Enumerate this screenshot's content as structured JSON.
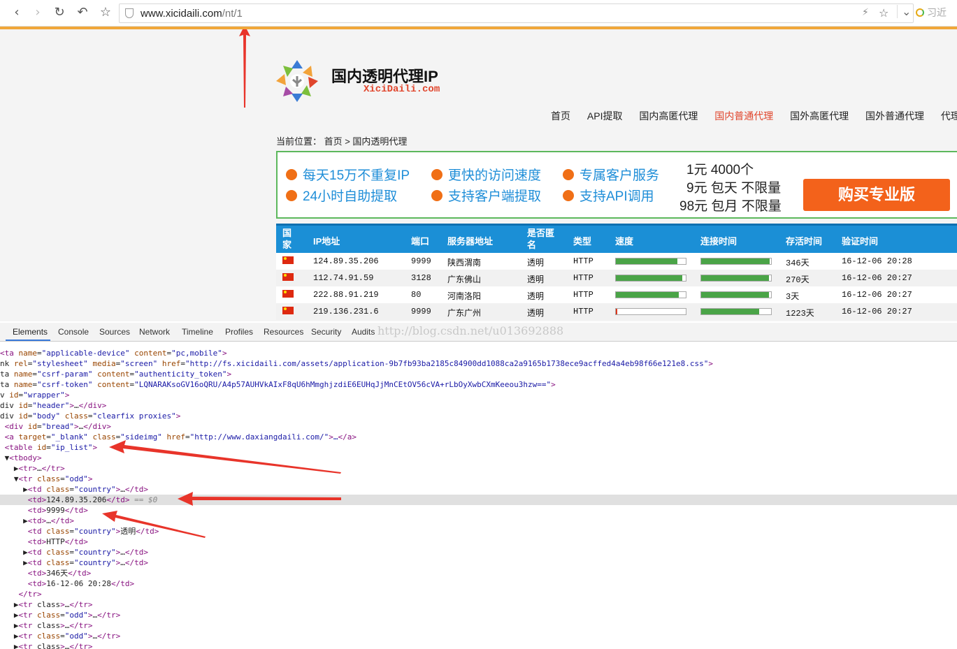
{
  "browser": {
    "url_domain": "www.xicidaili.com",
    "url_path": "/nt/1",
    "search_text": "习近",
    "back_icon": "‹",
    "forward_icon": "›",
    "reload_icon": "↻",
    "undo_icon": "↶",
    "star_icon": "☆",
    "bolt_icon": "⚡",
    "star2_icon": "☆",
    "dropdown_icon": "⌄"
  },
  "site": {
    "title": "国内透明代理IP",
    "title_en": "XiciDaili.com",
    "nav": [
      "首页",
      "API提取",
      "国内高匿代理",
      "国内普通代理",
      "国外高匿代理",
      "国外普通代理",
      "代理小"
    ],
    "breadcrumb": "当前位置： 首页 > 国内透明代理"
  },
  "promo": {
    "items": [
      "每天15万不重复IP",
      "更快的访问速度",
      "专属客户服务",
      "24小时自助提取",
      "支持客户端提取",
      "支持API调用"
    ],
    "prices": [
      "1元 4000个",
      "9元 包天 不限量",
      "98元 包月 不限量"
    ],
    "buy_label": "购买专业版"
  },
  "table": {
    "headers": [
      "国家",
      "IP地址",
      "端口",
      "服务器地址",
      "是否匿名",
      "类型",
      "速度",
      "连接时间",
      "存活时间",
      "验证时间"
    ],
    "rows": [
      {
        "ip": "124.89.35.206",
        "port": "9999",
        "location": "陕西渭南",
        "anonymity": "透明",
        "type": "HTTP",
        "speed": 0.88,
        "conn": 0.98,
        "alive": "346天",
        "verified": "16-12-06 20:28"
      },
      {
        "ip": "112.74.91.59",
        "port": "3128",
        "location": "广东佛山",
        "anonymity": "透明",
        "type": "HTTP",
        "speed": 0.95,
        "conn": 0.97,
        "alive": "270天",
        "verified": "16-12-06 20:27"
      },
      {
        "ip": "222.88.91.219",
        "port": "80",
        "location": "河南洛阳",
        "anonymity": "透明",
        "type": "HTTP",
        "speed": 0.9,
        "conn": 0.97,
        "alive": "3天",
        "verified": "16-12-06 20:27"
      },
      {
        "ip": "219.136.231.6",
        "port": "9999",
        "location": "广东广州",
        "anonymity": "透明",
        "type": "HTTP",
        "speed": 0.02,
        "conn": 0.83,
        "alive": "1223天",
        "verified": "16-12-06 20:27"
      }
    ]
  },
  "devtools": {
    "tabs": [
      "Elements",
      "Console",
      "Sources",
      "Network",
      "Timeline",
      "Profiles",
      "Resources",
      "Security",
      "Audits"
    ],
    "watermark": "http://blog.csdn.net/u013692888",
    "lines": [
      "<ta name=\"applicable-device\" content=\"pc,mobile\">",
      "nk rel=\"stylesheet\" media=\"screen\" href=\"http://fs.xicidaili.com/assets/application-9b7fb93ba2185c84900dd1088ca2a9165b1738ece9acffed4a4eb98f66e121e8.css\">",
      "ta name=\"csrf-param\" content=\"authenticity_token\">",
      "ta name=\"csrf-token\" content=\"LQNARAKsoGV16oQRU/A4p57AUHVkAIxF8qU6hMmghjzdiE6EUHqJjMnCEtOV56cVA+rLbOyXwbCXmKeeou3hzw==\">",
      "v id=\"wrapper\">",
      "div id=\"header\">…</div>",
      "div id=\"body\" class=\"clearfix proxies\">",
      " <div id=\"bread\">…</div>",
      " <a target=\"_blank\" class=\"sideimg\" href=\"http://www.daxiangdaili.com/\">…</a>",
      " <table id=\"ip_list\">",
      " ▼<tbody>",
      "   ▶<tr>…</tr>",
      "   ▼<tr class=\"odd\">",
      "     ▶<td class=\"country\">…</td>",
      "      <td>124.89.35.206</td> == $0",
      "      <td>9999</td>",
      "     ▶<td>…</td>",
      "      <td class=\"country\">透明</td>",
      "      <td>HTTP</td>",
      "     ▶<td class=\"country\">…</td>",
      "     ▶<td class=\"country\">…</td>",
      "      <td>346天</td>",
      "      <td>16-12-06 20:28</td>",
      "    </tr>",
      "   ▶<tr class>…</tr>",
      "   ▶<tr class=\"odd\">…</tr>",
      "   ▶<tr class>…</tr>",
      "   ▶<tr class=\"odd\">…</tr>",
      "   ▶<tr class>…</tr>"
    ]
  },
  "colors": {
    "accent_orange": "#f0a73a",
    "header_blue": "#1b8fd6",
    "promo_blue": "#1f8ed8",
    "buy_orange": "#f3621b",
    "bar_green": "#4aa447",
    "annotation_red": "#e8342a"
  }
}
